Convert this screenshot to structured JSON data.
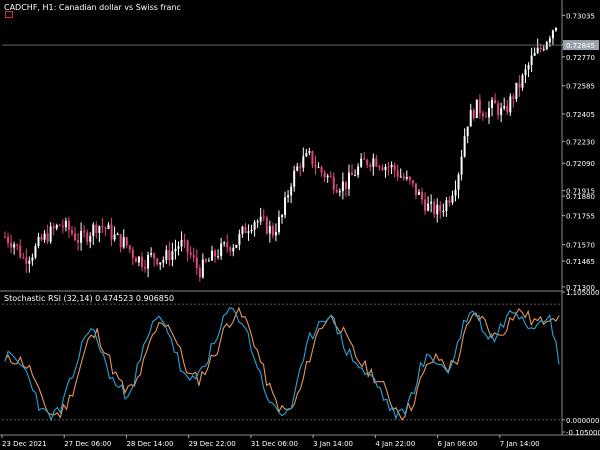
{
  "window": {
    "symbol_title": "CADCHF, H1:  Canadian dollar vs Swiss franc",
    "indicator_title": "Stochastic RSI (32,14) 0.474523 0.906850"
  },
  "colors": {
    "background": "#000000",
    "bull_candle": "#ffffff",
    "bear_candle": "#e04a7a",
    "stoch_k": "#2aa3d8",
    "stoch_d": "#e8955a",
    "grid_line": "#ffffff",
    "current_price_label_bg": "#9aa3ad"
  },
  "price_axis": {
    "labels": [
      "0.73035",
      "0.72850",
      "0.72770",
      "0.72585",
      "0.72405",
      "0.72230",
      "0.72090",
      "0.71915",
      "0.71880",
      "0.71755",
      "0.71570",
      "0.71465",
      "0.71300"
    ],
    "current_price": "0.72845"
  },
  "indicator_axis": {
    "labels": [
      "1.105000",
      "0.000000",
      "-0.105000"
    ]
  },
  "time_axis": {
    "labels": [
      "23 Dec 2021",
      "27 Dec 06:00",
      "28 Dec 14:00",
      "29 Dec 22:00",
      "31 Dec 06:00",
      "3 Jan 14:00",
      "4 Jan 22:00",
      "6 Jan 06:00",
      "7 Jan 14:00"
    ]
  },
  "chart_data": {
    "type": "candlestick",
    "title": "CADCHF, H1:  Canadian dollar vs Swiss franc",
    "close_path": [
      [
        0,
        0.7162
      ],
      [
        6,
        0.7158
      ],
      [
        12,
        0.7148
      ],
      [
        18,
        0.7152
      ],
      [
        24,
        0.716
      ],
      [
        30,
        0.7165
      ],
      [
        36,
        0.717
      ],
      [
        42,
        0.7166
      ],
      [
        48,
        0.716
      ],
      [
        54,
        0.7164
      ],
      [
        60,
        0.717
      ],
      [
        66,
        0.7167
      ],
      [
        72,
        0.7161
      ],
      [
        78,
        0.7158
      ],
      [
        84,
        0.715
      ],
      [
        90,
        0.7146
      ],
      [
        96,
        0.715
      ],
      [
        102,
        0.7147
      ],
      [
        108,
        0.7152
      ],
      [
        114,
        0.7158
      ],
      [
        120,
        0.7151
      ],
      [
        126,
        0.714
      ],
      [
        132,
        0.7146
      ],
      [
        138,
        0.7152
      ],
      [
        144,
        0.7156
      ],
      [
        150,
        0.7158
      ],
      [
        156,
        0.7167
      ],
      [
        162,
        0.7173
      ],
      [
        168,
        0.717
      ],
      [
        174,
        0.7165
      ],
      [
        180,
        0.7175
      ],
      [
        186,
        0.7198
      ],
      [
        192,
        0.721
      ],
      [
        198,
        0.7213
      ],
      [
        204,
        0.7205
      ],
      [
        210,
        0.72
      ],
      [
        216,
        0.7195
      ],
      [
        222,
        0.7196
      ],
      [
        228,
        0.7204
      ],
      [
        234,
        0.721
      ],
      [
        240,
        0.7212
      ],
      [
        246,
        0.7208
      ],
      [
        252,
        0.7206
      ],
      [
        258,
        0.72
      ],
      [
        264,
        0.7195
      ],
      [
        270,
        0.7187
      ],
      [
        276,
        0.718
      ],
      [
        282,
        0.7178
      ],
      [
        288,
        0.7186
      ],
      [
        294,
        0.72
      ],
      [
        300,
        0.7235
      ],
      [
        306,
        0.7245
      ],
      [
        312,
        0.7242
      ],
      [
        318,
        0.7246
      ],
      [
        324,
        0.724
      ],
      [
        330,
        0.7252
      ],
      [
        336,
        0.7262
      ],
      [
        342,
        0.7275
      ],
      [
        348,
        0.7282
      ],
      [
        354,
        0.7292
      ],
      [
        360,
        0.7302
      ]
    ],
    "stoch_k": [
      0.55,
      0.52,
      0.45,
      0.3,
      0.06,
      0.03,
      0.08,
      0.3,
      0.55,
      0.8,
      0.7,
      0.45,
      0.3,
      0.22,
      0.35,
      0.6,
      0.82,
      0.9,
      0.7,
      0.45,
      0.3,
      0.4,
      0.55,
      0.7,
      0.92,
      0.94,
      0.8,
      0.55,
      0.3,
      0.1,
      0.05,
      0.12,
      0.4,
      0.7,
      0.85,
      0.92,
      0.78,
      0.6,
      0.5,
      0.4,
      0.35,
      0.2,
      0.06,
      0.04,
      0.2,
      0.45,
      0.55,
      0.5,
      0.4,
      0.65,
      0.9,
      0.93,
      0.75,
      0.7,
      0.85,
      0.95,
      0.92,
      0.8,
      0.88,
      0.94,
      0.48
    ],
    "stoch_d": [
      0.5,
      0.53,
      0.5,
      0.4,
      0.15,
      0.05,
      0.05,
      0.18,
      0.42,
      0.68,
      0.75,
      0.58,
      0.38,
      0.25,
      0.28,
      0.48,
      0.72,
      0.86,
      0.8,
      0.58,
      0.38,
      0.35,
      0.47,
      0.62,
      0.82,
      0.93,
      0.87,
      0.68,
      0.42,
      0.2,
      0.08,
      0.08,
      0.26,
      0.55,
      0.78,
      0.89,
      0.85,
      0.69,
      0.55,
      0.45,
      0.38,
      0.28,
      0.13,
      0.05,
      0.12,
      0.33,
      0.5,
      0.53,
      0.45,
      0.52,
      0.78,
      0.92,
      0.84,
      0.72,
      0.78,
      0.9,
      0.94,
      0.86,
      0.84,
      0.91,
      0.9
    ],
    "y_range": [
      0.7128,
      0.7312
    ],
    "indicator_range": [
      -0.105,
      1.105
    ]
  }
}
